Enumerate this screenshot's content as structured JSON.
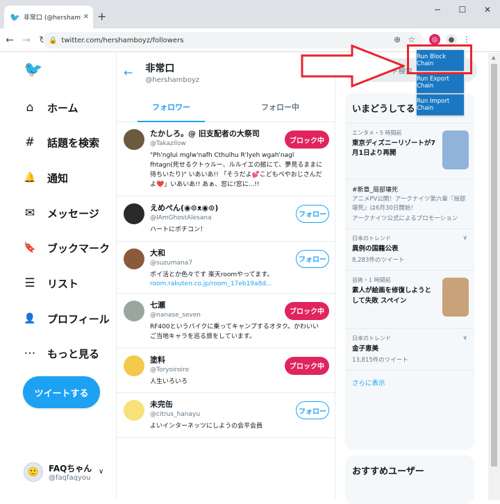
{
  "browser": {
    "tab_title": "非常口 (@hershamboyz) さんを",
    "url": "twitter.com/hershamboyz/followers"
  },
  "nav": {
    "items": [
      {
        "label": "ホーム",
        "icon": "home-icon",
        "glyph": "⌂"
      },
      {
        "label": "話題を検索",
        "icon": "hashtag-icon",
        "glyph": "#"
      },
      {
        "label": "通知",
        "icon": "bell-icon",
        "glyph": "🔔"
      },
      {
        "label": "メッセージ",
        "icon": "mail-icon",
        "glyph": "✉"
      },
      {
        "label": "ブックマーク",
        "icon": "bookmark-icon",
        "glyph": "🔖"
      },
      {
        "label": "リスト",
        "icon": "list-icon",
        "glyph": "☰"
      },
      {
        "label": "プロフィール",
        "icon": "profile-icon",
        "glyph": "👤"
      },
      {
        "label": "もっと見る",
        "icon": "more-icon",
        "glyph": "⋯"
      }
    ],
    "tweet_button": "ツイートする",
    "account_name": "FAQちゃん",
    "account_handle": "@faqfaqyou"
  },
  "profile": {
    "name": "非常口",
    "handle": "@hershamboyz",
    "tabs": [
      "フォロワー",
      "フォロー中"
    ]
  },
  "users": [
    {
      "name": "たかしろ。@ 旧支配者の大祭司",
      "handle": "@Takazilow",
      "bio": "\"Ph'nglui mglw'nafh Cthulhu R'lyeh wgah'nagl fhtagn(死せるクトゥルー、ルルイエの館にて、夢見るままに待ちいたり)\" いあいあ!! 「そうだよ💕こどもぺやおじさんだよ❤️」いあいあ!! あぁ、窓に!窓に...!!",
      "link": "",
      "button": "ブロック中",
      "color": "#6b5a3e"
    },
    {
      "name": "えめぺん(◉⊙ᴥ◉⊙)",
      "handle": "@IAmGhostAlesana",
      "bio": "ハートにボチコン！",
      "link": "",
      "button": "フォロー",
      "color": "#2a2a2a"
    },
    {
      "name": "大和",
      "handle": "@suzumana7",
      "bio": "ポイ活とか色々です 楽天roomやってます。",
      "link": "room.rakuten.co.jp/room_17eb19a8d...",
      "button": "フォロー",
      "color": "#8a5a3a"
    },
    {
      "name": "七瀬",
      "handle": "@nanase_seven",
      "bio": "RF400というバイクに乗ってキャンプするオタク。かわいいご当地キャラを巡る旅をしています。",
      "link": "",
      "button": "ブロック中",
      "color": "#9aa7a0"
    },
    {
      "name": "塗料",
      "handle": "@Toryoiroiro",
      "bio": "人生いろいろ",
      "link": "",
      "button": "ブロック中",
      "color": "#f2c94c"
    },
    {
      "name": "未完缶",
      "handle": "@citrus_hanayu",
      "bio": "よいインターネッツにしようの会平会員",
      "link": "",
      "button": "フォロー",
      "color": "#f7e27a"
    }
  ],
  "search_placeholder": "キーワード検索",
  "trends": {
    "heading": "いまどうしてる？",
    "items": [
      {
        "meta": "エンタメ・5 時間前",
        "title": "東京ディズニーリゾートが7月1日より再開",
        "desc": "",
        "thumb": "#8fb3d9"
      },
      {
        "meta": "#新章_局部壊死",
        "title": "",
        "desc": "アニメPV公開！アークナイツ第六章『局部壊死』は6月30日開始！",
        "promo": "アークナイツ公式によるプロモーション"
      },
      {
        "meta": "日本のトレンド",
        "title": "異例の国籍公表",
        "desc": "8,283件のツイート"
      },
      {
        "meta": "芸術・1 時間前",
        "title": "素人が絵画を修復しようとして失敗 スペイン",
        "desc": "",
        "thumb": "#c9a27a"
      },
      {
        "meta": "日本のトレンド",
        "title": "金子恵美",
        "desc": "13,815件のツイート"
      }
    ],
    "more": "さらに表示"
  },
  "recommend_heading": "おすすめユーザー",
  "extension": {
    "buttons": [
      "Run Block Chain",
      "Run Export Chain",
      "Run Import Chain"
    ]
  }
}
